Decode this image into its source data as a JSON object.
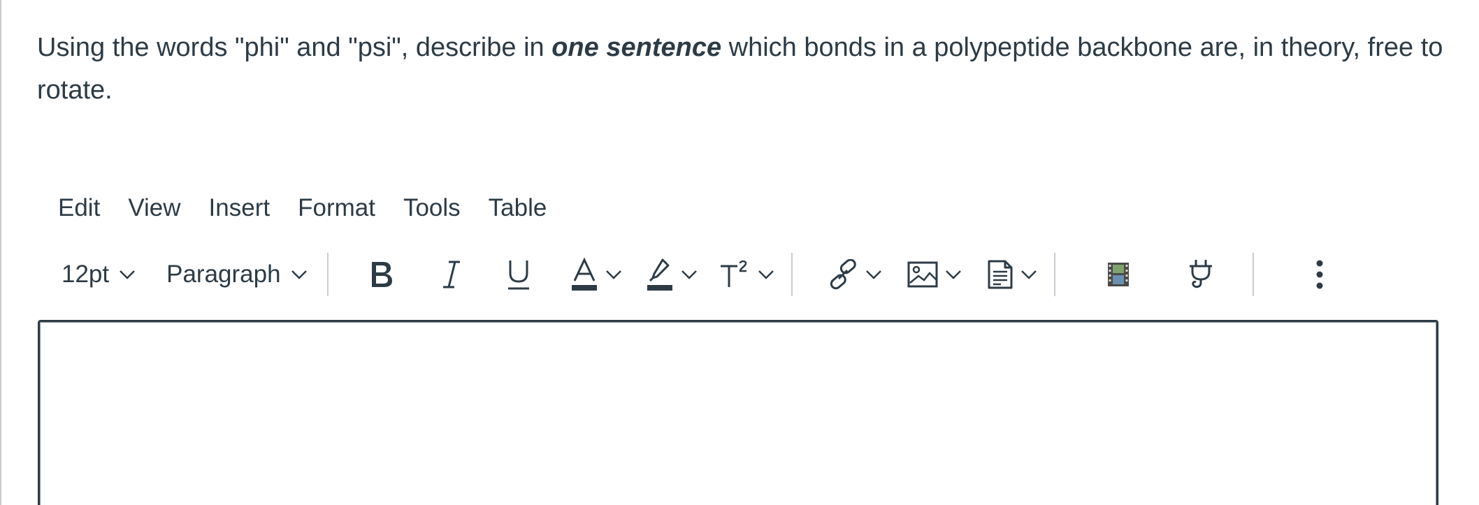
{
  "question": {
    "before": "Using the words \"phi\" and \"psi\", describe in ",
    "emphasis": "one sentence",
    "after": " which bonds in a polypeptide backbone are, in theory, free to rotate."
  },
  "menubar": {
    "edit": "Edit",
    "view": "View",
    "insert": "Insert",
    "format": "Format",
    "tools": "Tools",
    "table": "Table"
  },
  "toolbar": {
    "font_size": "12pt",
    "block_format": "Paragraph",
    "icons": [
      "bold-icon",
      "italic-icon",
      "underline-icon",
      "text-color-icon",
      "highlight-icon",
      "superscript-icon",
      "link-icon",
      "image-icon",
      "document-icon",
      "media-icon",
      "plugin-icon",
      "more-icon"
    ]
  },
  "editor": {
    "value": ""
  },
  "colors": {
    "text": "#2d3b45",
    "border": "#2d3b45",
    "separator": "#c7cdd1"
  }
}
